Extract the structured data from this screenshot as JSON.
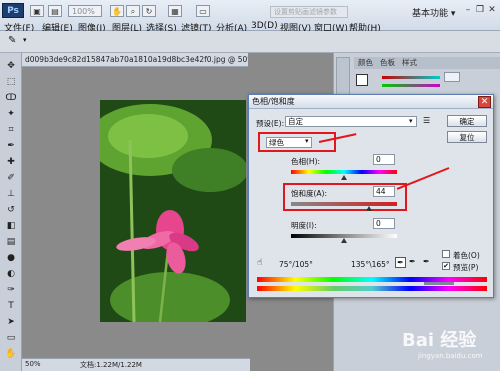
{
  "app": {
    "logo": "Ps",
    "menus": [
      "文件(F)",
      "编辑(E)",
      "图像(I)",
      "图层(L)",
      "选择(S)",
      "滤镜(T)",
      "分析(A)",
      "3D(D)",
      "视图(V)",
      "窗口(W)",
      "帮助(H)"
    ],
    "zoom": "100%",
    "workspace": "基本功能 ▾"
  },
  "options": {
    "placeholder": "设置剪贴画滤镜参数"
  },
  "document": {
    "tab": "d009b3de9c82d15847ab70a1810a19d8bc3e42f0.jpg @ 50%(RGB/8)",
    "zoom": "50%",
    "status": "文档:1.22M/1.22M"
  },
  "panels": {
    "tabs": [
      "颜色",
      "色板",
      "样式"
    ]
  },
  "dialog": {
    "title": "色相/饱和度",
    "preset_label": "预设(E):",
    "preset_value": "自定",
    "ok": "确定",
    "cancel": "复位",
    "channel": "绿色",
    "hue_label": "色相(H):",
    "hue_value": "0",
    "saturation_label": "饱和度(A):",
    "saturation_value": "44",
    "lightness_label": "明度(I):",
    "lightness_value": "0",
    "range_left": "75°/105°",
    "range_right": "135°\\165°",
    "colorize": "着色(O)",
    "preview": "预览(P)",
    "preview_checked": true,
    "accent": "#e2171d"
  },
  "watermark": {
    "brand": "Bai 经验",
    "url": "jingyan.baidu.com"
  }
}
